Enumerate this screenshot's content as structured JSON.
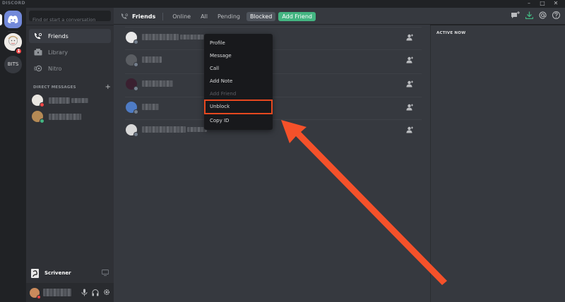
{
  "window": {
    "title": "DISCORD"
  },
  "servers": {
    "home_label": "Home",
    "badge": "1",
    "bits_label": "BITS"
  },
  "sidebar": {
    "search_placeholder": "Find or start a conversation",
    "nav": [
      {
        "label": "Friends",
        "icon": "friends-icon"
      },
      {
        "label": "Library",
        "icon": "library-icon"
      },
      {
        "label": "Nitro",
        "icon": "nitro-icon"
      }
    ],
    "dm_header": "DIRECT MESSAGES",
    "dm_add": "+",
    "game": {
      "label": "Scrivener"
    }
  },
  "topbar": {
    "title": "Friends",
    "tabs": [
      "Online",
      "All",
      "Pending",
      "Blocked"
    ],
    "active_tab": "Blocked",
    "add_friend": "Add Friend"
  },
  "context_menu": {
    "items": [
      "Profile",
      "Message",
      "Call",
      "Add Note",
      "Add Friend",
      "Unblock",
      "Copy ID"
    ],
    "disabled": "Add Friend",
    "highlighted": "Unblock"
  },
  "activity": {
    "title": "ACTIVE NOW"
  },
  "colors": {
    "blurple": "#7289da",
    "green": "#43b581",
    "red": "#f04747",
    "annotation": "#f5512a"
  }
}
